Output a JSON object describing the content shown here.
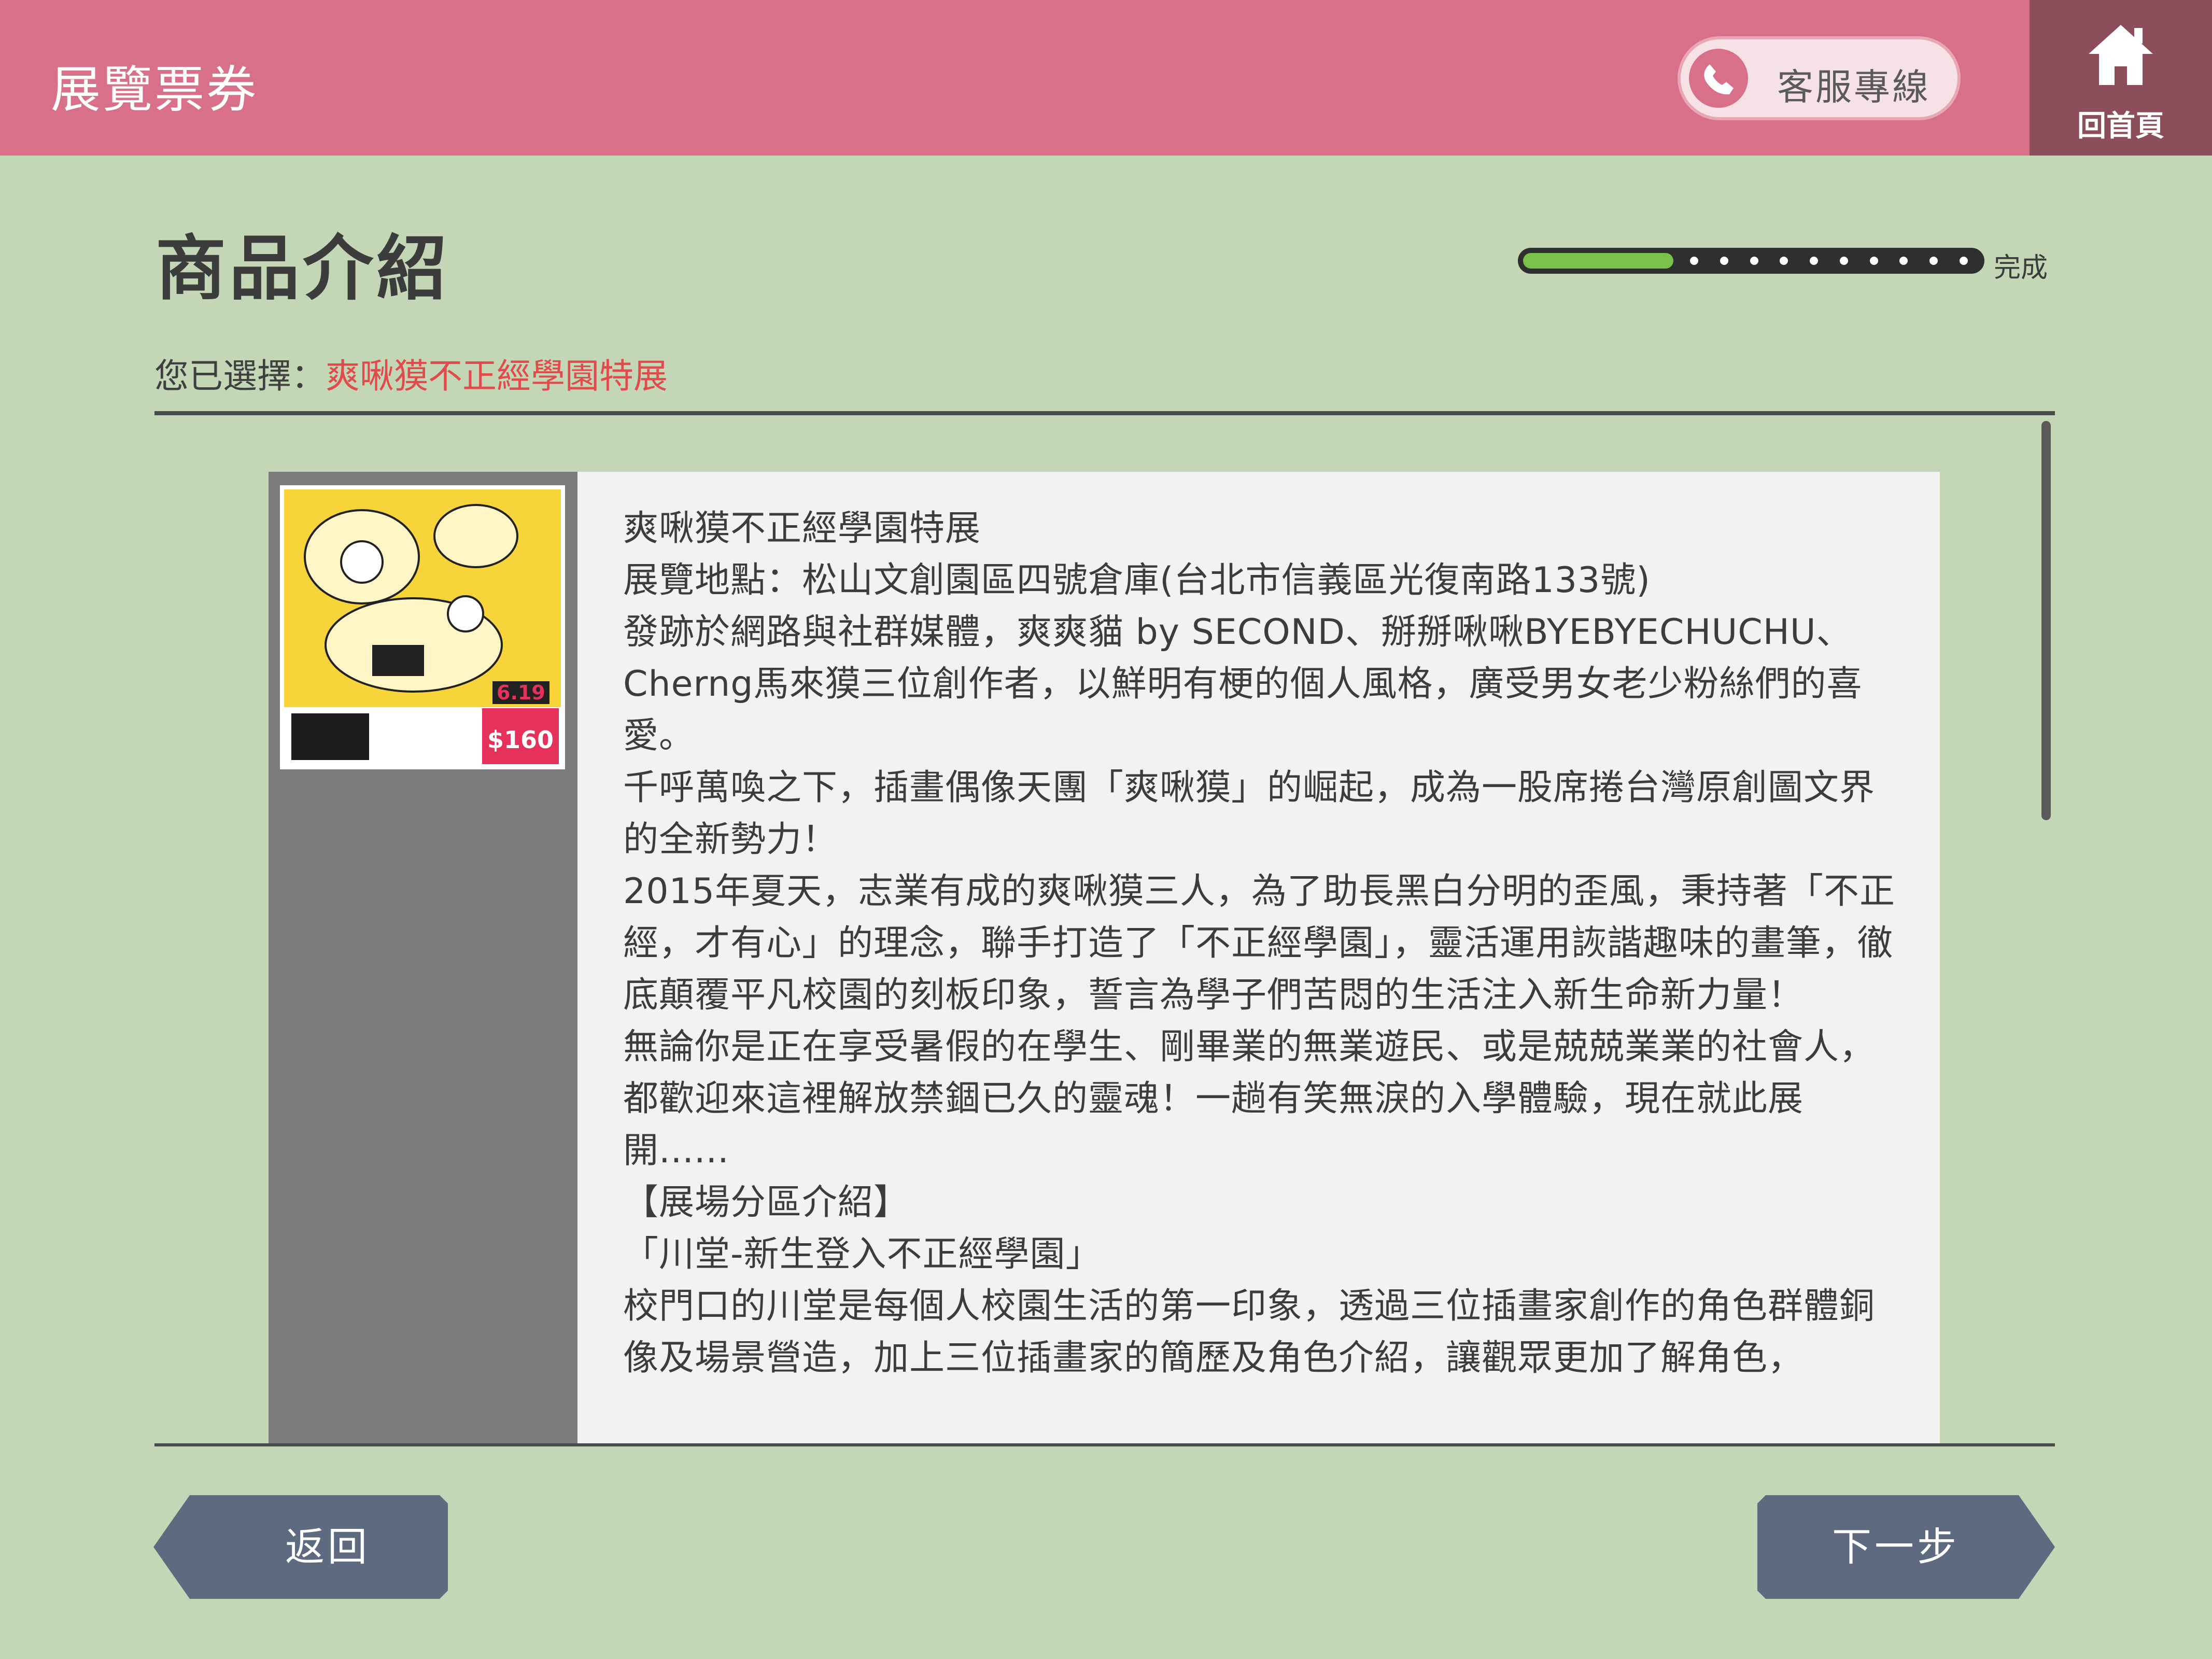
{
  "header": {
    "title": "展覽票券",
    "hotline_label": "客服專線",
    "hotline_icon": "phone-icon",
    "home_label": "回首頁",
    "home_icon": "home-icon"
  },
  "page": {
    "title": "商品介紹",
    "progress_label": "完成",
    "progress_fraction": 0.33,
    "selected_prefix": "您已選擇：",
    "selected_value": "爽啾獏不正經學園特展"
  },
  "product": {
    "image_alt": "爽啾獏不正經學園特展 poster",
    "poster_date": "6.19",
    "poster_price": "$160",
    "paragraphs": [
      "爽啾獏不正經學園特展",
      "展覽地點：松山文創園區四號倉庫(台北市信義區光復南路133號)",
      "發跡於網路與社群媒體，爽爽貓 by SECOND、掰掰啾啾BYEBYECHUCHU、Cherng馬來獏三位創作者，以鮮明有梗的個人風格，廣受男女老少粉絲們的喜愛。",
      "千呼萬喚之下，插畫偶像天團「爽啾獏」的崛起，成為一股席捲台灣原創圖文界的全新勢力！",
      "2015年夏天，志業有成的爽啾獏三人，為了助長黑白分明的歪風，秉持著「不正經，才有心」的理念，聯手打造了「不正經學園」，靈活運用詼諧趣味的畫筆，徹底顛覆平凡校園的刻板印象，誓言為學子們苦悶的生活注入新生命新力量！",
      "無論你是正在享受暑假的在學生、剛畢業的無業遊民、或是兢兢業業的社會人，都歡迎來這裡解放禁錮已久的靈魂！一趟有笑無淚的入學體驗，現在就此展開......",
      "【展場分區介紹】",
      "「川堂-新生登入不正經學園」",
      "校門口的川堂是每個人校園生活的第一印象，透過三位插畫家創作的角色群體銅像及場景營造，加上三位插畫家的簡歷及角色介紹，讓觀眾更加了解角色，"
    ]
  },
  "nav": {
    "back_label": "返回",
    "next_label": "下一步"
  },
  "colors": {
    "header_bg": "#d87089",
    "home_bg": "#8b4e5a",
    "page_bg": "#c3d6b5",
    "accent_red": "#e24b4b",
    "progress_fill": "#79c24a",
    "button_bg": "#5d6a80"
  }
}
